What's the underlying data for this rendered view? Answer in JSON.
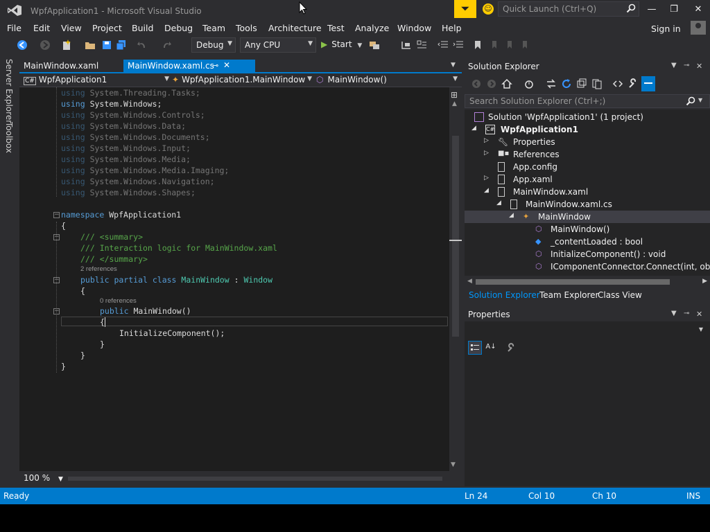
{
  "window": {
    "title": "WpfApplication1 - Microsoft Visual Studio",
    "quick_launch_placeholder": "Quick Launch (Ctrl+Q)",
    "controls": {
      "minimize": "—",
      "restore": "❐",
      "close": "✕"
    }
  },
  "menu": [
    "File",
    "Edit",
    "View",
    "Project",
    "Build",
    "Debug",
    "Team",
    "Tools",
    "Architecture",
    "Test",
    "Analyze",
    "Window",
    "Help"
  ],
  "account": {
    "sign_in": "Sign in"
  },
  "toolbar": {
    "configuration": "Debug",
    "platform": "Any CPU",
    "start_label": "Start"
  },
  "side_tabs": [
    "Server Explorer",
    "Toolbox"
  ],
  "doc_tabs": [
    {
      "label": "MainWindow.xaml",
      "active": false
    },
    {
      "label": "MainWindow.xaml.cs",
      "active": true
    }
  ],
  "navbar": {
    "project": "WpfApplication1",
    "type": "WpfApplication1.MainWindow",
    "member": "MainWindow()"
  },
  "code": {
    "usings": [
      {
        "kw": "using",
        "ns": "System.Threading.Tasks;",
        "active": false
      },
      {
        "kw": "using",
        "ns": "System.Windows;",
        "active": true
      },
      {
        "kw": "using",
        "ns": "System.Windows.Controls;",
        "active": false
      },
      {
        "kw": "using",
        "ns": "System.Windows.Data;",
        "active": false
      },
      {
        "kw": "using",
        "ns": "System.Windows.Documents;",
        "active": false
      },
      {
        "kw": "using",
        "ns": "System.Windows.Input;",
        "active": false
      },
      {
        "kw": "using",
        "ns": "System.Windows.Media;",
        "active": false
      },
      {
        "kw": "using",
        "ns": "System.Windows.Media.Imaging;",
        "active": false
      },
      {
        "kw": "using",
        "ns": "System.Windows.Navigation;",
        "active": false
      },
      {
        "kw": "using",
        "ns": "System.Windows.Shapes;",
        "active": false
      }
    ],
    "ns_kw": "namespace",
    "ns_name": "WpfApplication1",
    "open_brace": "{",
    "close_brace": "}",
    "doc_summary_open": "/// <summary>",
    "doc_summary_text": "/// Interaction logic for MainWindow.xaml",
    "doc_summary_close": "/// </summary>",
    "class_refs": "2 references",
    "class_kw": "public partial class",
    "class_name": "MainWindow",
    "class_colon": ":",
    "base_class": "Window",
    "ctor_refs": "0 references",
    "ctor_kw": "public",
    "ctor_sig": "MainWindow()",
    "ctor_body": "InitializeComponent();"
  },
  "editor": {
    "zoom": "100 %"
  },
  "status": {
    "ready": "Ready",
    "line": "Ln 24",
    "col": "Col 10",
    "ch": "Ch 10",
    "mode": "INS"
  },
  "solution_explorer": {
    "title": "Solution Explorer",
    "search_placeholder": "Search Solution Explorer (Ctrl+;)",
    "tree": [
      {
        "label": "Solution 'WpfApplication1' (1 project)",
        "icon": "solution-icon",
        "expander": ""
      },
      {
        "label": "WpfApplication1",
        "icon": "csharp-project-icon",
        "expander": "◢",
        "bold": true
      },
      {
        "label": "Properties",
        "icon": "wrench-icon",
        "expander": "▷"
      },
      {
        "label": "References",
        "icon": "references-icon",
        "expander": "▷"
      },
      {
        "label": "App.config",
        "icon": "config-file-icon",
        "expander": ""
      },
      {
        "label": "App.xaml",
        "icon": "xaml-file-icon",
        "expander": "▷"
      },
      {
        "label": "MainWindow.xaml",
        "icon": "xaml-file-icon",
        "expander": "◢"
      },
      {
        "label": "MainWindow.xaml.cs",
        "icon": "cs-file-icon",
        "expander": "◢"
      },
      {
        "label": "MainWindow",
        "icon": "class-icon",
        "expander": "◢",
        "selected": true
      },
      {
        "label": "MainWindow()",
        "icon": "method-icon",
        "expander": ""
      },
      {
        "label": "_contentLoaded : bool",
        "icon": "field-icon",
        "expander": ""
      },
      {
        "label": "InitializeComponent() : void",
        "icon": "method-icon",
        "expander": ""
      },
      {
        "label": "IComponentConnector.Connect(int, objec",
        "icon": "method-icon",
        "expander": ""
      }
    ]
  },
  "tool_tabs": [
    "Solution Explorer",
    "Team Explorer",
    "Class View"
  ],
  "properties": {
    "title": "Properties"
  },
  "colors": {
    "accent": "#007acc",
    "background": "#2d2d30",
    "editor": "#1e1e1e",
    "keyword": "#569cd6",
    "type": "#4ec9b0",
    "comment": "#57a64a"
  }
}
